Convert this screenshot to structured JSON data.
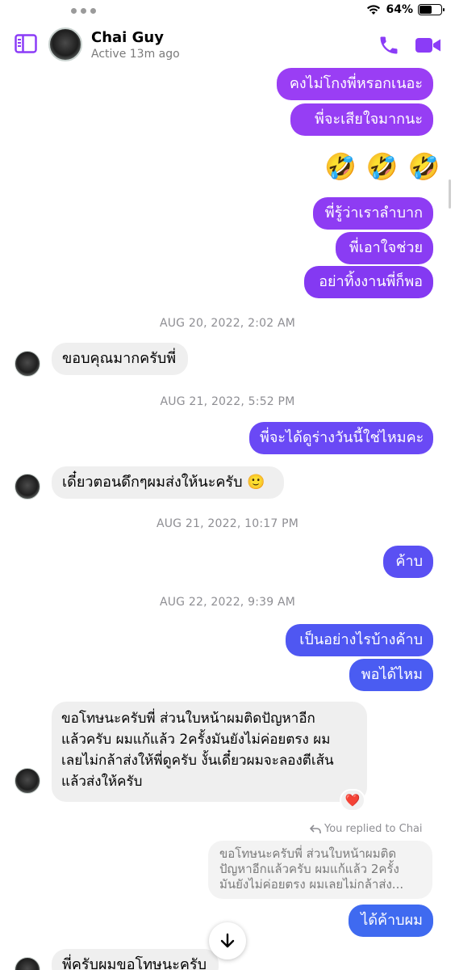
{
  "status_bar": {
    "battery_text": "64%",
    "battery_level": 0.64
  },
  "header": {
    "name": "Chai Guy",
    "status": "Active 13m ago"
  },
  "colors": {
    "accent": "#8b3cf7",
    "purple_bubble": "#8a3bf2",
    "violet_bubble": "#6c47f5",
    "blue_bubble": "#3f6af0",
    "incoming_bubble": "#efefef"
  },
  "messages": {
    "m1": "คงไม่โกงพี่หรอกเนอะ",
    "m2": "พี่จะเสียใจมากนะ",
    "emoji": [
      "🤣",
      "🤣",
      "🤣"
    ],
    "m3": "พี่รู้ว่าเราลำบาก",
    "m4": "พี่เอาใจช่วย",
    "m5": "อย่าทิ้งงานพี่ก็พอ",
    "ts1": "AUG 20, 2022, 2:02 AM",
    "m6": "ขอบคุณมากครับพี่",
    "ts2": "AUG 21, 2022, 5:52 PM",
    "m7": "พี่จะได้ดูร่างวันนี้ใช่ไหมคะ",
    "m8": "เดี๋ยวตอนดึกๆผมส่งให้นะครับ 🙂",
    "ts3": "AUG 21, 2022, 10:17 PM",
    "m9": "ค้าบ",
    "ts4": "AUG 22, 2022, 9:39 AM",
    "m10": "เป็นอย่างไรบ้างค้าบ",
    "m11": "พอได้ไหม",
    "m12_lines": [
      "ขอโทษนะครับพี่ ส่วนใบหน้าผมติดปัญหาอีก",
      "แล้วครับ ผมแก้แล้ว 2ครั้งมันยังไม่ค่อยตรง ผม",
      "เลยไม่กล้าส่งให้พี่ดูครับ งั้นเดี๋ยวผมจะลองตีเส้น",
      "แล้วส่งให้ครับ"
    ],
    "reaction": "❤️",
    "replied_label": "You replied to Chai",
    "quoted_lines": [
      "ขอโทษนะครับพี่ ส่วนใบหน้าผมติด",
      "ปัญหาอีกแล้วครับ ผมแก้แล้ว 2ครั้ง",
      "มันยังไม่ค่อยตรง ผมเลยไม่กล้าส่ง..."
    ],
    "m13": "ได้ค้าบผม",
    "m14": "พี่ครับผมขอโทษนะครับ"
  }
}
